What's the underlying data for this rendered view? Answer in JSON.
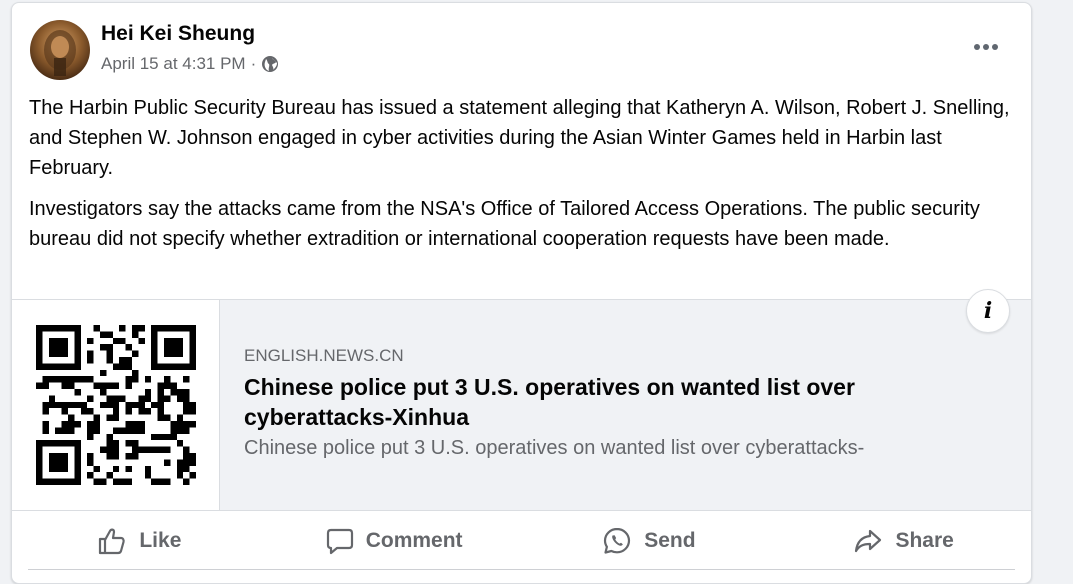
{
  "post": {
    "author": "Hei Kei Sheung",
    "timestamp": "April 15 at 4:31 PM",
    "separator": "·",
    "privacy_icon": "globe-icon",
    "more_icon": "ellipsis-icon",
    "paragraphs": [
      "The Harbin Public Security Bureau has issued a statement alleging that Katheryn A. Wilson, Robert J. Snelling, and Stephen W. Johnson engaged in cyber activities during the Asian Winter Games held in Harbin last February.",
      "Investigators say the attacks came from the NSA's Office of Tailored Access Operations. The public security bureau did not specify whether extradition or international cooperation requests have been made."
    ]
  },
  "link_preview": {
    "thumbnail": "qr-code",
    "domain": "ENGLISH.NEWS.CN",
    "title": "Chinese police put 3 U.S. operatives on wanted list over cyberattacks-Xinhua",
    "description": "Chinese police put 3 U.S. operatives on wanted list over cyberattacks-",
    "info_icon": "i"
  },
  "actions": {
    "like": "Like",
    "comment": "Comment",
    "send": "Send",
    "share": "Share"
  },
  "colors": {
    "background": "#f0f2f5",
    "card": "#ffffff",
    "text_primary": "#050505",
    "text_secondary": "#65676b"
  }
}
